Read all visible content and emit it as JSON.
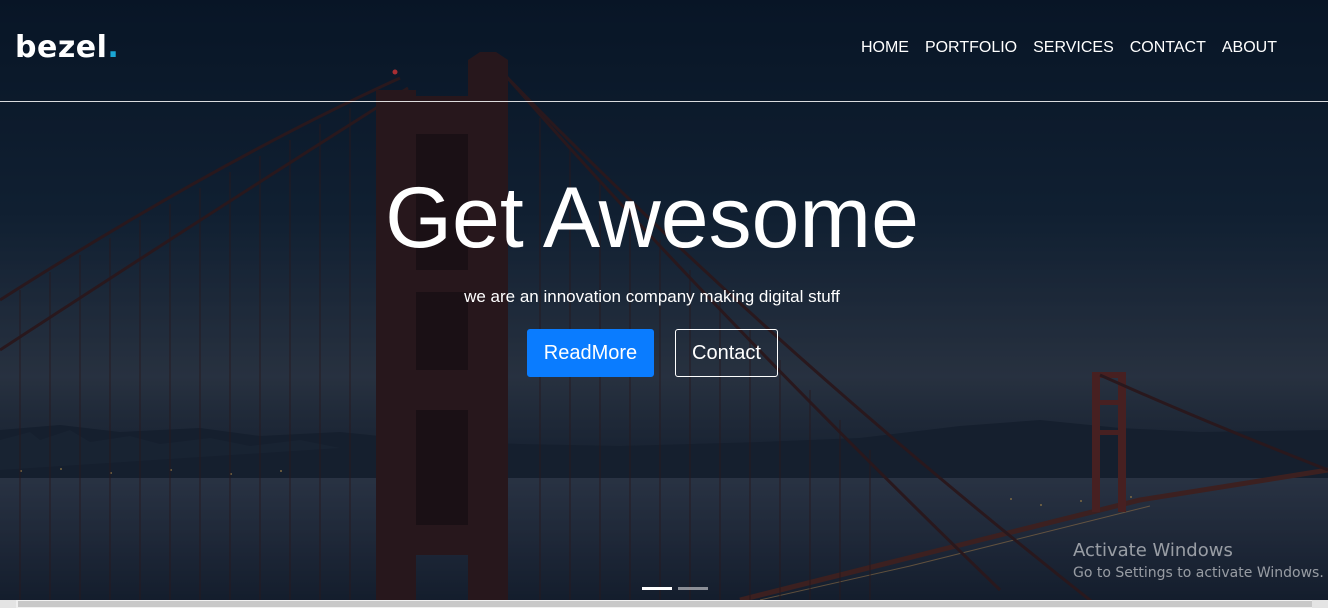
{
  "brand": {
    "name": "bezel",
    "dot": ".",
    "dot_color": "#1aa6d4"
  },
  "nav": {
    "items": [
      {
        "label": "HOME"
      },
      {
        "label": "PORTFOLIO"
      },
      {
        "label": "SERVICES"
      },
      {
        "label": "CONTACT"
      },
      {
        "label": "ABOUT"
      }
    ]
  },
  "hero": {
    "title": "Get Awesome",
    "subtitle": "we are an innovation company making digital stuff",
    "primary_button": "ReadMore",
    "secondary_button": "Contact",
    "primary_color": "#0a7cff",
    "background_icon": "golden-gate-bridge-night-photo"
  },
  "carousel": {
    "slides": 2,
    "active": 1
  },
  "watermark": {
    "title": "Activate Windows",
    "subtitle": "Go to Settings to activate Windows."
  }
}
